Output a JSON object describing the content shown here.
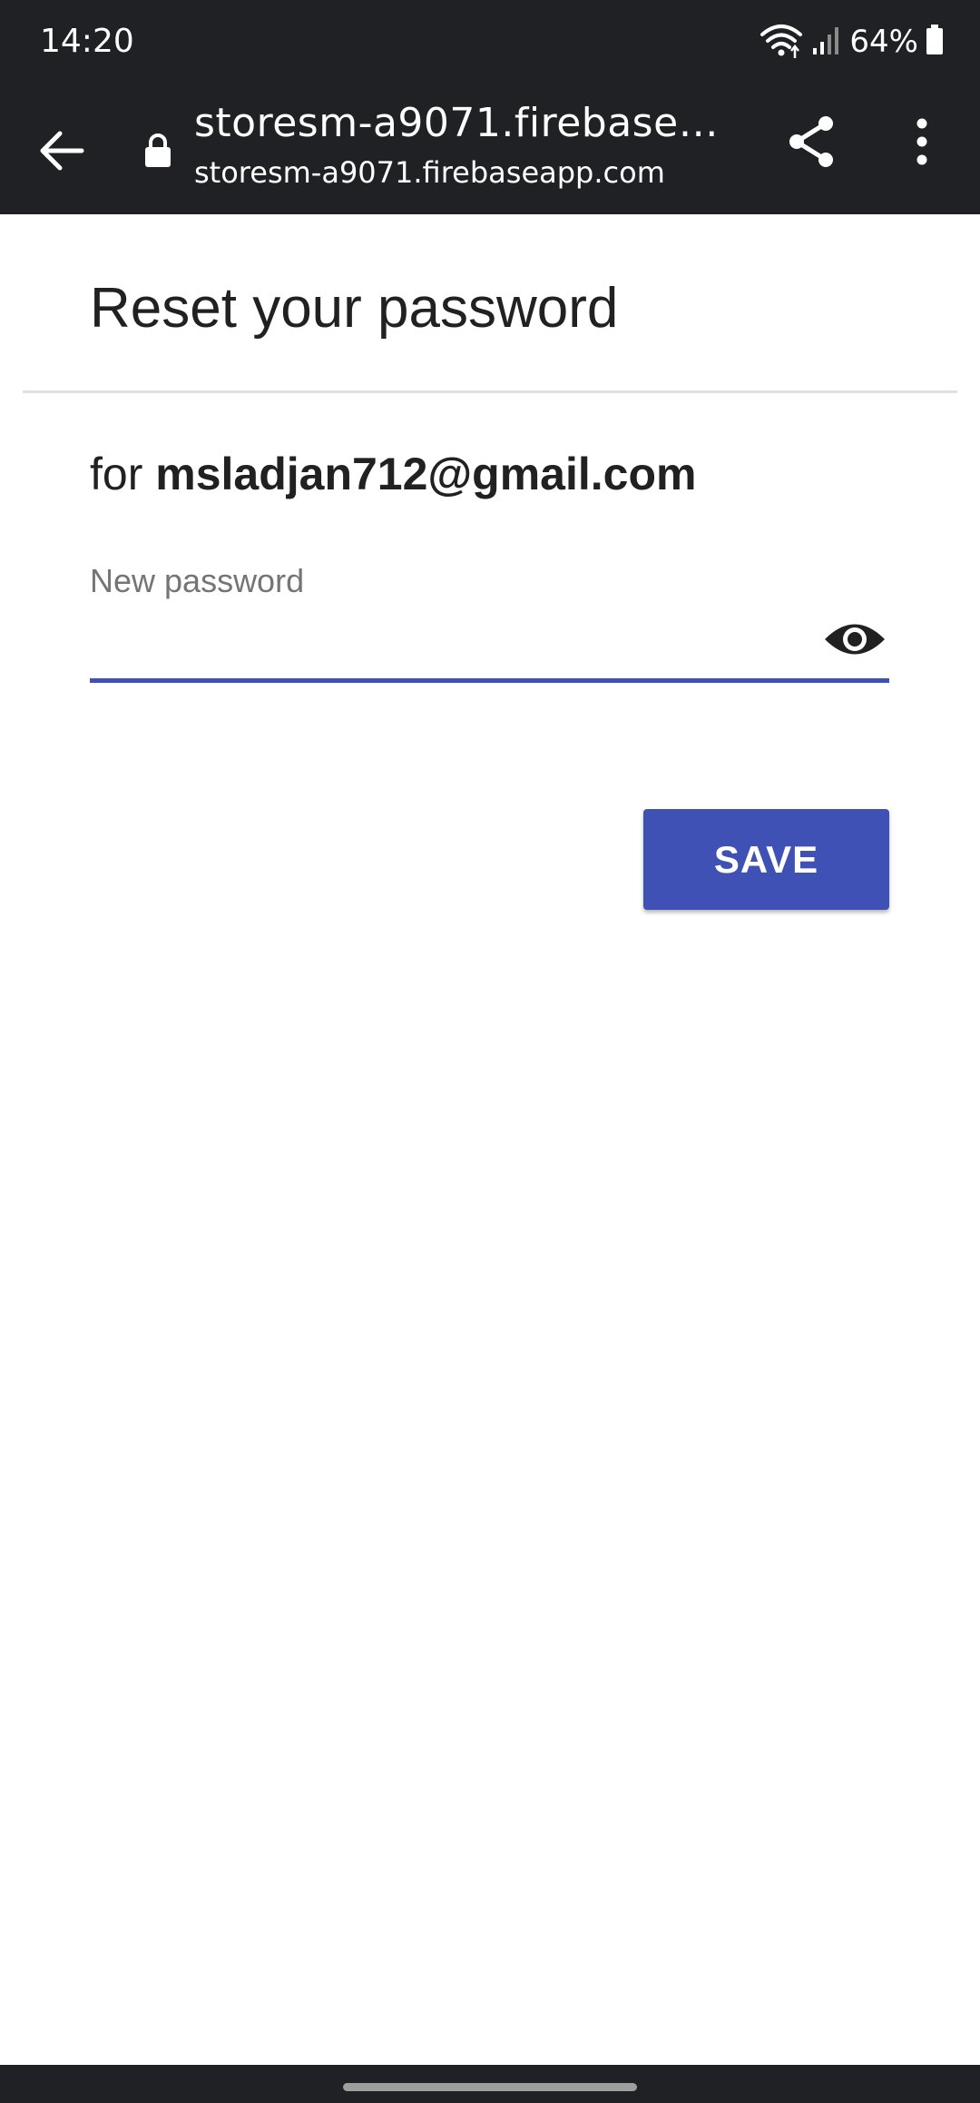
{
  "status_bar": {
    "time": "14:20",
    "battery_percent": "64%",
    "icons": [
      "wifi-icon",
      "signal-icon",
      "battery-icon"
    ]
  },
  "browser": {
    "page_title": "storesm-a9071.firebasea...",
    "url": "storesm-a9071.firebaseapp.com",
    "icons": [
      "back-arrow-icon",
      "lock-icon",
      "share-icon",
      "more-vert-icon"
    ]
  },
  "page": {
    "heading": "Reset your password",
    "for_prefix": "for ",
    "email": "msladjan712@gmail.com",
    "new_password_label": "New password",
    "new_password_value": "",
    "show_password_icon": "eye-icon",
    "save_label": "SAVE"
  },
  "colors": {
    "accent": "#3f51b5",
    "toolbar_bg": "#202124",
    "text": "#212121",
    "label": "#757575",
    "divider": "#e0e0e0"
  }
}
